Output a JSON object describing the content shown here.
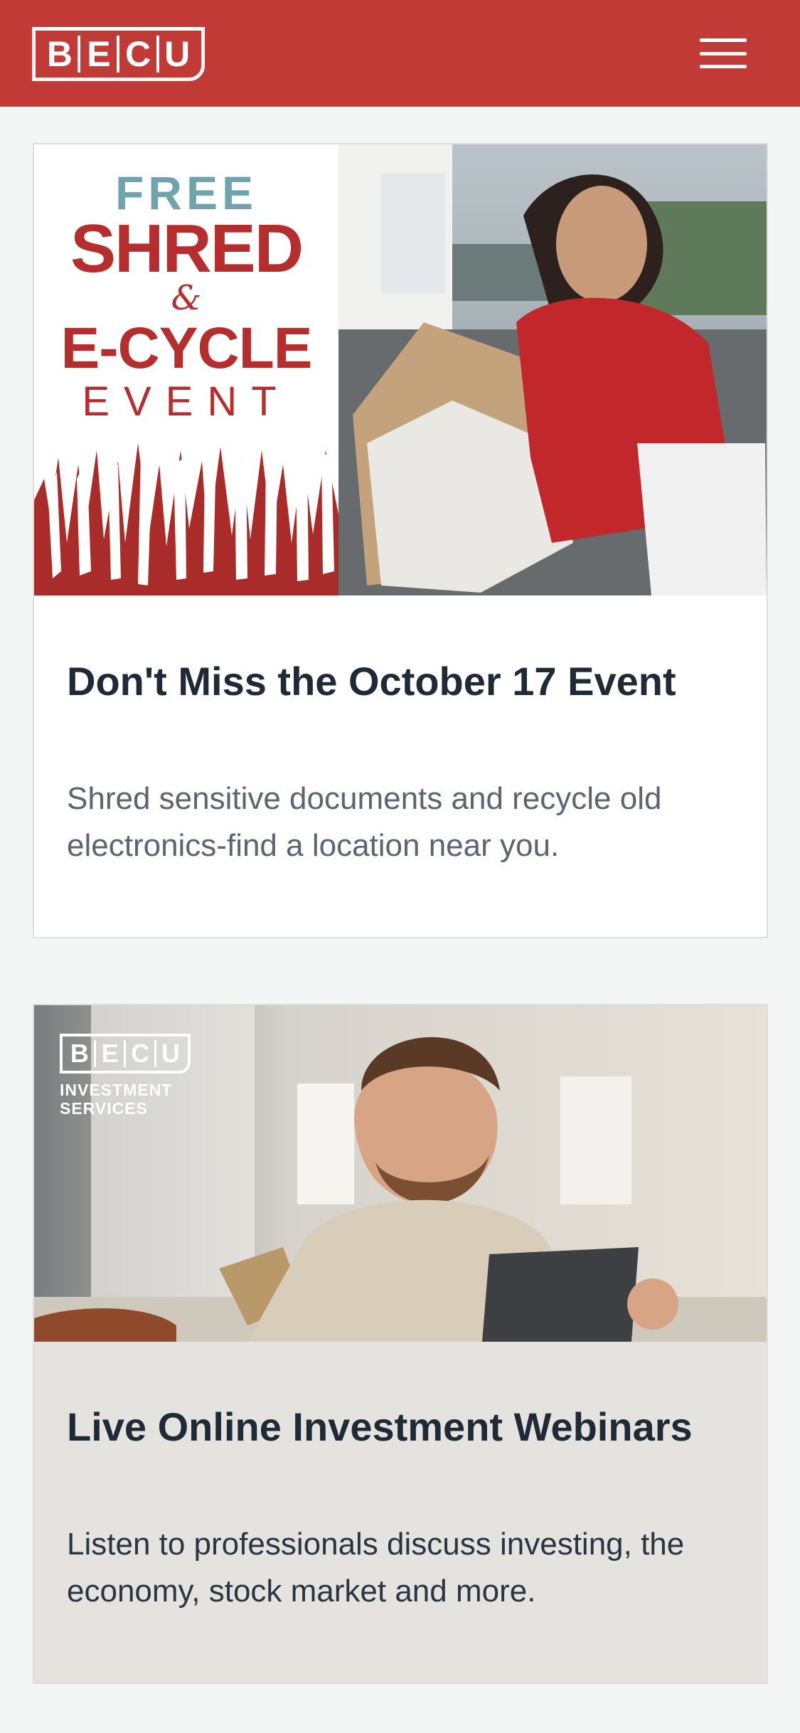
{
  "header": {
    "logo_letters": [
      "B",
      "E",
      "C",
      "U"
    ],
    "menu_icon": "hamburger-menu-icon",
    "brand_color": "#c13a36"
  },
  "cards": [
    {
      "banner": {
        "line1": "FREE",
        "line2": "SHRED",
        "line3": "&",
        "line4": "E-CYCLE",
        "line5": "EVENT"
      },
      "title": "Don't Miss the October 17 Event",
      "description": "Shred sensitive documents and recycle old electronics-find a location near you."
    },
    {
      "overlay_logo": {
        "letters": [
          "B",
          "E",
          "C",
          "U"
        ],
        "subtitle1": "INVESTMENT",
        "subtitle2": "SERVICES"
      },
      "title": "Live Online Investment Webinars",
      "description": "Listen to professionals discuss investing, the economy, stock market and more."
    }
  ]
}
